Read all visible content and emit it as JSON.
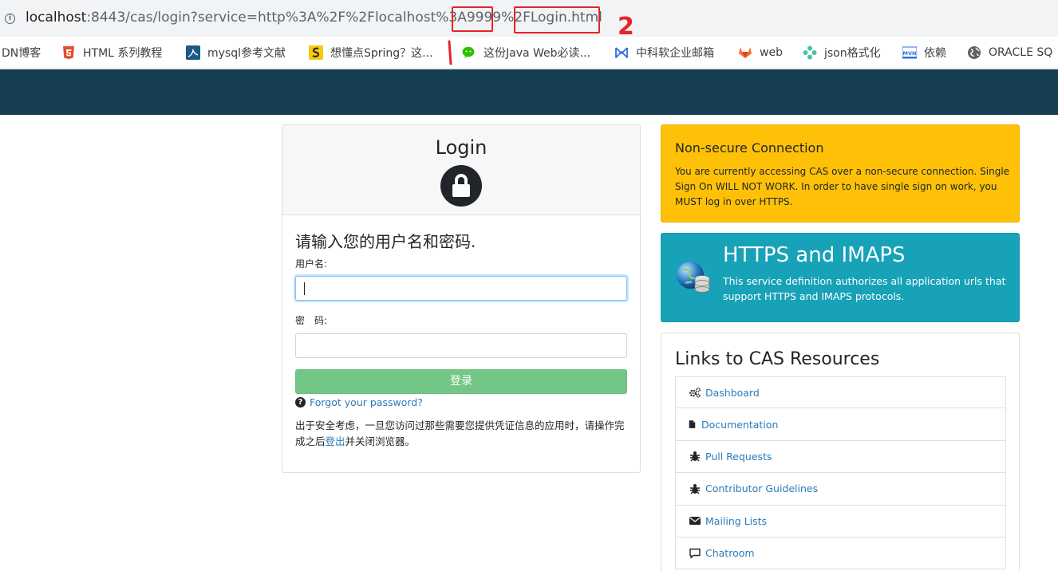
{
  "browser": {
    "url_host": "localhost",
    "url_rest": ":8443/cas/login?service=http%3A%2F%2Flocalhost%3A9999%2FLogin.html",
    "annotation_1": "1",
    "annotation_2": "2",
    "bookmarks": [
      {
        "label": "DN博客",
        "icon": "csdn-icon"
      },
      {
        "label": "HTML 系列教程",
        "icon": "html5-icon"
      },
      {
        "label": "mysql参考文献",
        "icon": "mysql-icon"
      },
      {
        "label": "想懂点Spring？这...",
        "icon": "spring-bookmark-icon"
      },
      {
        "label": "这份Java Web必读...",
        "icon": "wechat-icon"
      },
      {
        "label": "中科软企业邮箱",
        "icon": "mail-logo-icon"
      },
      {
        "label": "web",
        "icon": "gitlab-icon"
      },
      {
        "label": "json格式化",
        "icon": "json-icon"
      },
      {
        "label": "依赖",
        "icon": "mvn-icon"
      },
      {
        "label": "ORACLE SQ",
        "icon": "globe-icon"
      }
    ]
  },
  "login": {
    "title": "Login",
    "prompt": "请输入您的用户名和密码.",
    "username_label": "用户名:",
    "username_value": "",
    "password_label": "密　码:",
    "password_value": "",
    "submit_label": "登录",
    "forgot_label": "Forgot your password?",
    "notice_before": "出于安全考虑，一旦您访问过那些需要您提供凭证信息的应用时，请操作完成之后",
    "notice_link": "登出",
    "notice_after": "并关闭浏览器。"
  },
  "warning": {
    "title": "Non-secure Connection",
    "text": "You are currently accessing CAS over a non-secure connection. Single Sign On WILL NOT WORK. In order to have single sign on work, you MUST log in over HTTPS."
  },
  "service": {
    "title": "HTTPS and IMAPS",
    "text": "This service definition authorizes all application urls that support HTTPS and IMAPS protocols."
  },
  "links": {
    "title": "Links to CAS Resources",
    "items": [
      {
        "label": "Dashboard",
        "icon": "gears-icon"
      },
      {
        "label": "Documentation",
        "icon": "file-icon"
      },
      {
        "label": "Pull Requests",
        "icon": "bug-icon"
      },
      {
        "label": "Contributor Guidelines",
        "icon": "bug-icon"
      },
      {
        "label": "Mailing Lists",
        "icon": "envelope-icon"
      },
      {
        "label": "Chatroom",
        "icon": "comment-icon"
      }
    ]
  },
  "colors": {
    "nav": "#153e50",
    "warning": "#ffc107",
    "service": "#17a2b8",
    "submit": "#74c687",
    "link": "#2c7bb6",
    "annotation": "#e8232a"
  }
}
